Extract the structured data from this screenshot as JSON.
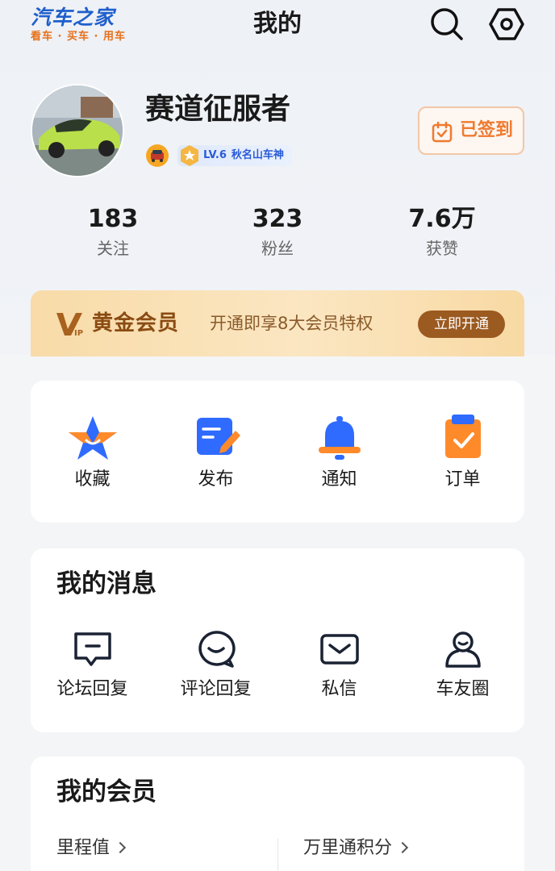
{
  "header": {
    "logo_title": "汽车之家",
    "logo_sub": "看车 · 买车 · 用车",
    "page_title": "我的",
    "icons": [
      "search-icon",
      "settings-icon"
    ]
  },
  "profile": {
    "username": "赛道征服者",
    "level": "LV.6",
    "level_title": "秋名山车神",
    "checkin_label": "已签到"
  },
  "stats": [
    {
      "value": "183",
      "label": "关注"
    },
    {
      "value": "323",
      "label": "粉丝"
    },
    {
      "value": "7.6万",
      "label": "获赞"
    }
  ],
  "vip": {
    "title": "黄金会员",
    "desc": "开通即享8大会员特权",
    "button": "立即开通"
  },
  "shortcuts": [
    {
      "label": "收藏",
      "icon": "star-icon"
    },
    {
      "label": "发布",
      "icon": "edit-icon"
    },
    {
      "label": "通知",
      "icon": "bell-icon"
    },
    {
      "label": "订单",
      "icon": "clipboard-icon"
    }
  ],
  "messages": {
    "title": "我的消息",
    "items": [
      {
        "label": "论坛回复",
        "icon": "forum-reply-icon"
      },
      {
        "label": "评论回复",
        "icon": "comment-reply-icon"
      },
      {
        "label": "私信",
        "icon": "mail-icon"
      },
      {
        "label": "车友圈",
        "icon": "user-circle-icon"
      }
    ]
  },
  "membership": {
    "title": "我的会员",
    "links": [
      "里程值",
      "万里通积分"
    ]
  },
  "colors": {
    "brand_blue": "#1f5fcc",
    "brand_orange": "#e6701a",
    "vip_gold": "#f8dba8",
    "vip_button": "#9b5a20",
    "checkin_orange": "#f07a2e"
  }
}
